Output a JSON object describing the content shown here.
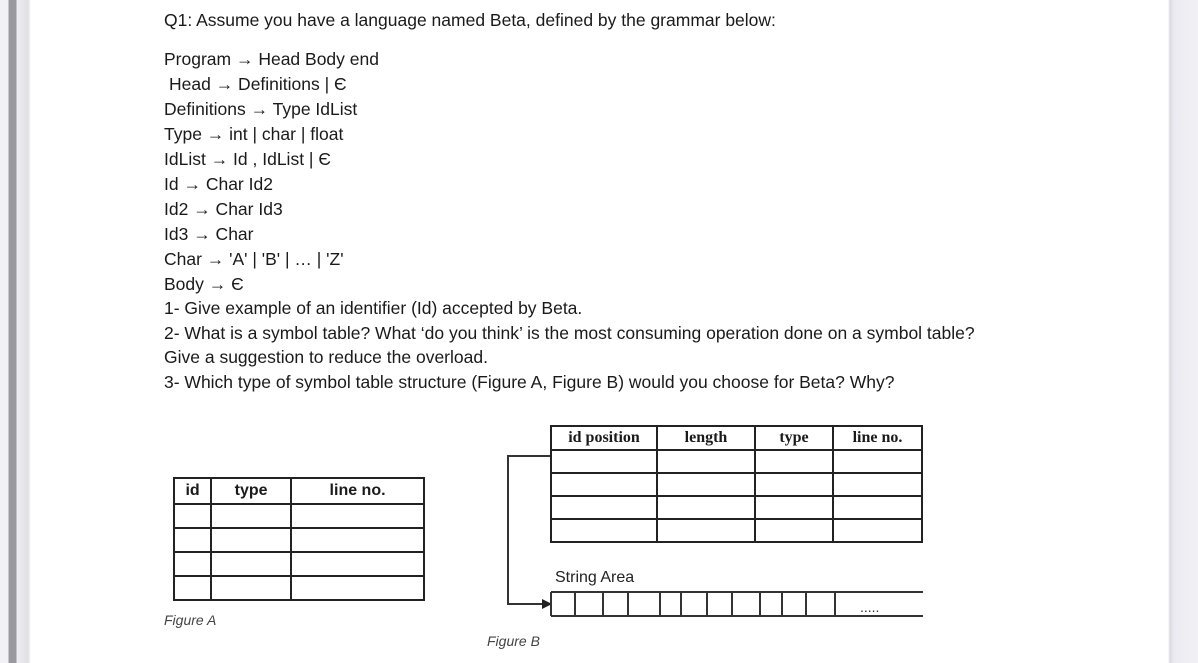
{
  "document": {
    "title": "Q1: Assume you have a language named Beta, defined by the grammar below:",
    "grammar": [
      "Program → Head Body end",
      "Head → Definitions | Є",
      "Definitions → Type IdList",
      "Type → int | char | float",
      "IdList → Id , IdList | Є",
      "Id → Char Id2",
      "Id2 → Char Id3",
      "Id3 → Char",
      "Char → 'A' | 'B' | … | 'Z'",
      "Body → Є"
    ],
    "questions": [
      "1- Give example of an identifier (Id) accepted by Beta.",
      "2- What is a symbol table? What ‘do you think’ is the most consuming operation done on a symbol table? Give a suggestion to reduce the overload.",
      "3- Which type of symbol table structure (Figure A, Figure B) would you choose for Beta? Why?"
    ]
  },
  "figure_a": {
    "caption": "Figure A",
    "columns": [
      "id",
      "type",
      "line no."
    ],
    "empty_rows": 4
  },
  "figure_b": {
    "caption": "Figure B",
    "columns": [
      "id position",
      "length",
      "type",
      "line no."
    ],
    "empty_rows": 4,
    "string_area_label": "String Area",
    "string_area_cells": 11,
    "ellipsis": "....."
  }
}
